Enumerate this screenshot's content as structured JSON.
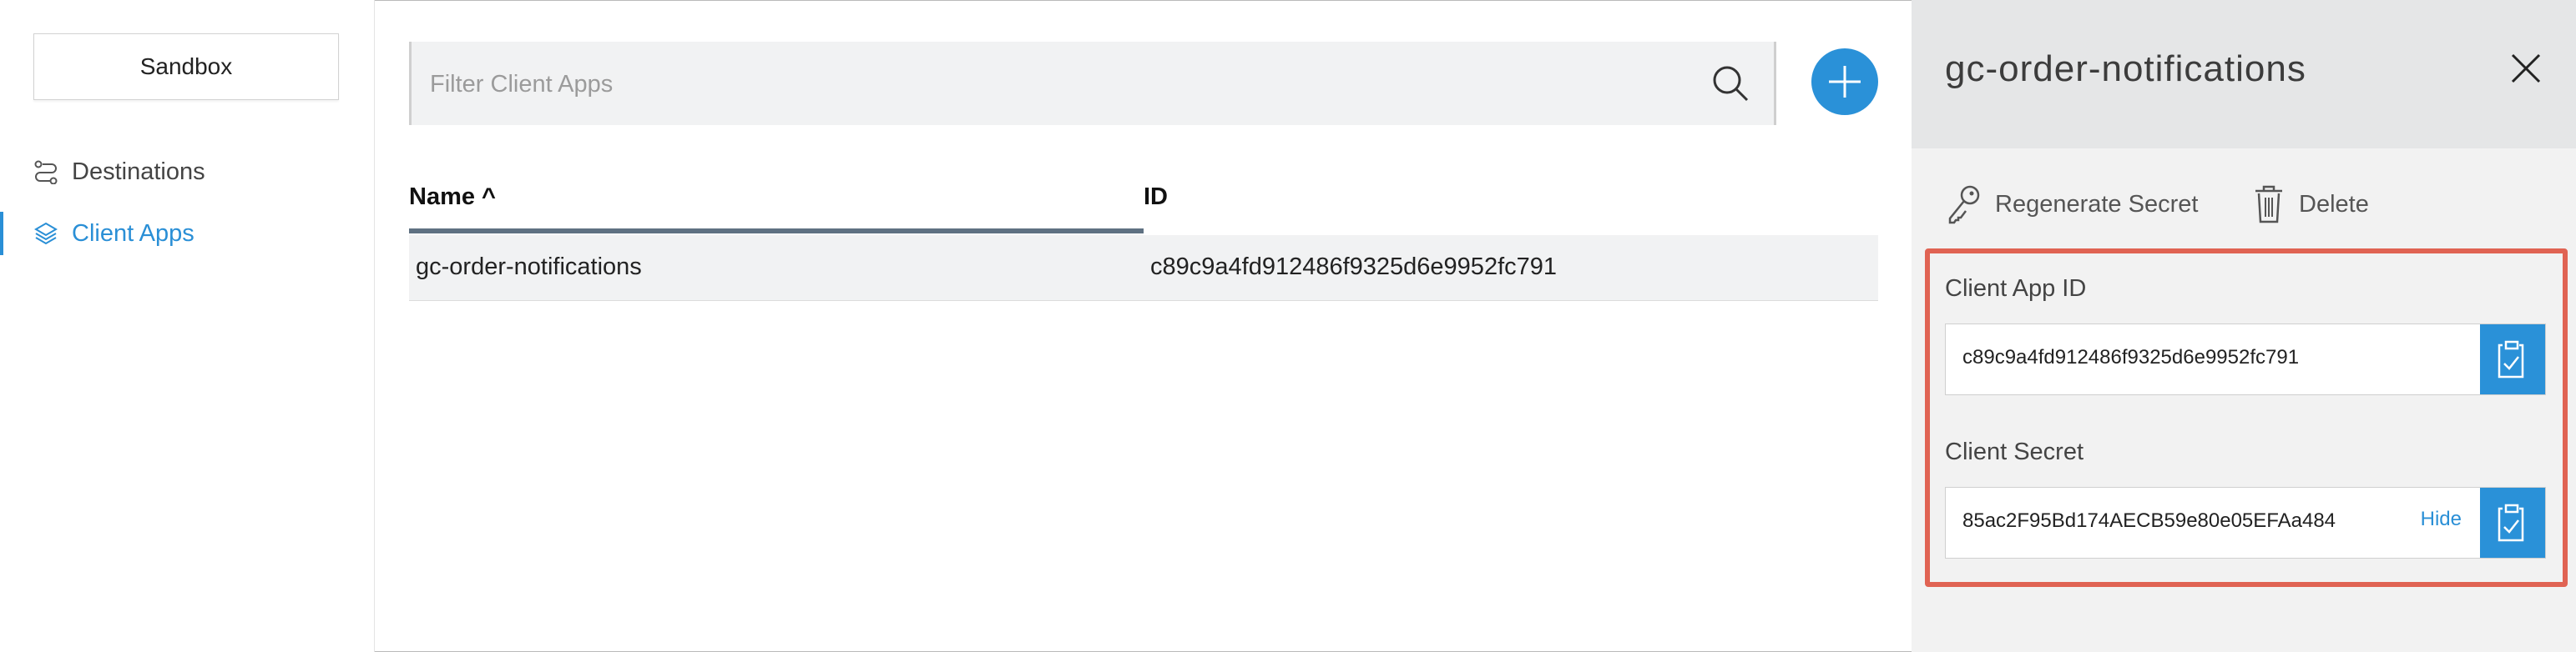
{
  "sidebar": {
    "environment_label": "Sandbox",
    "items": [
      {
        "label": "Destinations",
        "icon": "destinations-icon",
        "active": false
      },
      {
        "label": "Client Apps",
        "icon": "client-apps-icon",
        "active": true
      }
    ]
  },
  "search": {
    "placeholder": "Filter Client Apps",
    "value": ""
  },
  "table": {
    "columns": [
      "Name ^",
      "ID"
    ],
    "rows": [
      {
        "name": "gc-order-notifications",
        "id": "c89c9a4fd912486f9325d6e9952fc791"
      }
    ]
  },
  "panel": {
    "title": "gc-order-notifications",
    "actions": {
      "regenerate": "Regenerate Secret",
      "delete": "Delete"
    },
    "client_app_id": {
      "label": "Client App ID",
      "value": "c89c9a4fd912486f9325d6e9952fc791"
    },
    "client_secret": {
      "label": "Client Secret",
      "value": "85ac2F95Bd174AECB59e80e05EFAa484",
      "toggle": "Hide"
    }
  },
  "colors": {
    "accent": "#2a91d8",
    "highlight": "#e06353",
    "sort_bar": "#5f7182"
  }
}
